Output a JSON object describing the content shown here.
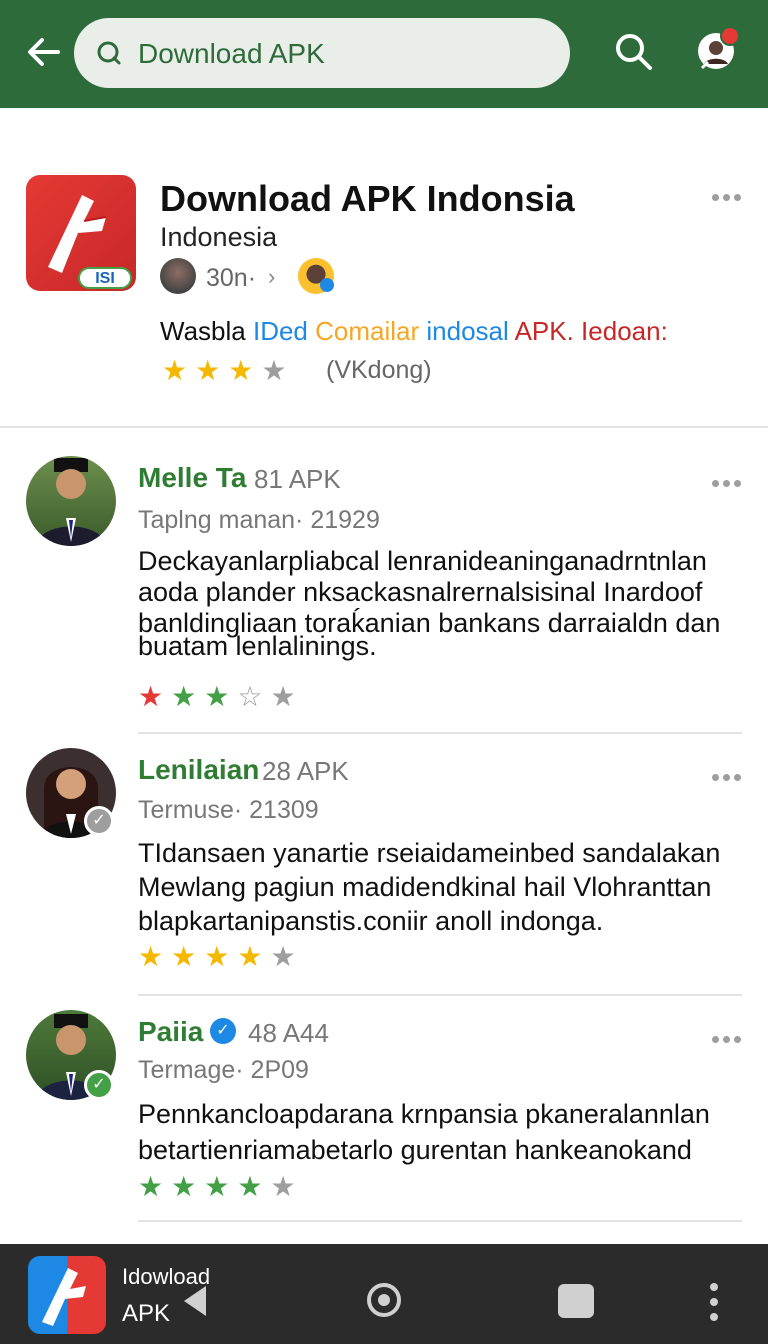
{
  "search": {
    "value": "Download APK"
  },
  "app": {
    "title": "Download APK Indonsia",
    "subtitle": "Indonesia",
    "meta": "30n·",
    "badge": "ISI",
    "tagline": [
      {
        "text": "Wasbla ",
        "color": "#111111"
      },
      {
        "text": "IDed ",
        "color": "#1e88e5"
      },
      {
        "text": "Comailar ",
        "color": "#f5a623"
      },
      {
        "text": "indosal ",
        "color": "#1e88e5"
      },
      {
        "text": "APK. ",
        "color": "#c62828"
      },
      {
        "text": "Iedoan:",
        "color": "#c62828"
      }
    ],
    "rating": 3,
    "rating_text": "(VKdong)"
  },
  "reviews": [
    {
      "name": "Melle Ta",
      "count": "81 APK",
      "meta": "Taplng manan· 21929",
      "body": [
        "Deckayanlarpliabcal lenranideaninganadrntnlan",
        "aoda plander nksackasnalrernalsisinal Inardoof",
        "banldingliaan toraḱanian bankans darraialdn dan",
        "buatam lenlalinings."
      ],
      "stars": [
        {
          "glyph": "★",
          "color": "#e53935"
        },
        {
          "glyph": "★",
          "color": "#43a047"
        },
        {
          "glyph": "★",
          "color": "#43a047"
        },
        {
          "glyph": "☆",
          "color": "#9e9e9e"
        },
        {
          "glyph": "★",
          "color": "#9e9e9e"
        }
      ]
    },
    {
      "name": "Lenilaian",
      "count": "28 APK",
      "meta": "Termuse· 21309",
      "body": [
        "TIdansaen yanartie rseiaidameinbed sandalakan",
        "Mewlang pagiun madidendkinal hail Vlohranttan",
        "blapkartanipanstis.coniir anoll indonga."
      ],
      "stars": [
        {
          "glyph": "★",
          "color": "#f5b800"
        },
        {
          "glyph": "★",
          "color": "#f5b800"
        },
        {
          "glyph": "★",
          "color": "#f5b800"
        },
        {
          "glyph": "★",
          "color": "#f5b800"
        },
        {
          "glyph": "★",
          "color": "#9e9e9e"
        }
      ]
    },
    {
      "name": "Paiia",
      "count": "48 A44",
      "meta": "Termage· 2P09",
      "body": [
        "Pennkancloapdarana krnpansia pkaneralannlan",
        "betartienriamabetarlo gurentan hankeanokand"
      ],
      "stars": [
        {
          "glyph": "★",
          "color": "#43a047"
        },
        {
          "glyph": "★",
          "color": "#43a047"
        },
        {
          "glyph": "★",
          "color": "#43a047"
        },
        {
          "glyph": "★",
          "color": "#43a047"
        },
        {
          "glyph": "★",
          "color": "#9e9e9e"
        }
      ]
    }
  ],
  "bottom": {
    "line1": "Idowload",
    "line2": "APK"
  },
  "colors": {
    "brand_green": "#2e6b3a",
    "name_green": "#2e7d32",
    "notification_red": "#e53935"
  }
}
